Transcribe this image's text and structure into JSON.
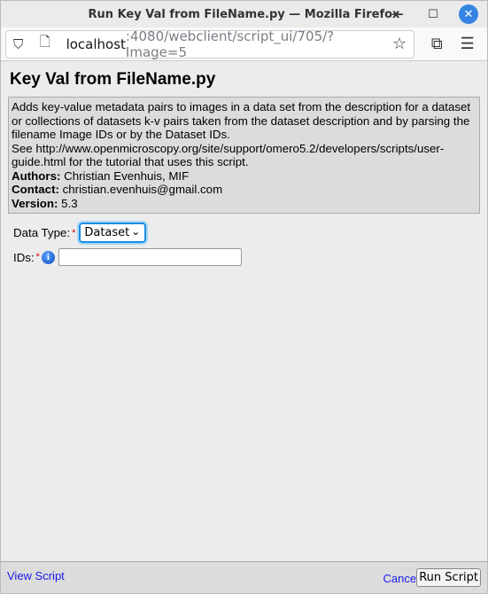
{
  "window": {
    "title": "Run Key Val from FileName.py — Mozilla Firefox"
  },
  "browser": {
    "url_host": "localhost",
    "url_rest": ":4080/webclient/script_ui/705/?Image=5"
  },
  "page": {
    "title": "Key Val from FileName.py",
    "description": "Adds key-value metadata pairs to images in a data set from the description for a dataset or collections of datasets k-v pairs taken from the dataset description and by parsing the filename Image IDs or by the Dataset IDs.",
    "tutorial": "See http://www.openmicroscopy.org/site/support/omero5.2/developers/scripts/user-guide.html for the tutorial that uses this script.",
    "authors_label": "Authors:",
    "authors": "Christian Evenhuis, MIF",
    "contact_label": "Contact:",
    "contact": "christian.evenhuis@gmail.com",
    "version_label": "Version:",
    "version": "5.3"
  },
  "form": {
    "data_type_label": "Data Type:",
    "data_type_value": "Dataset",
    "ids_label": "IDs:",
    "ids_value": "",
    "required_mark": "*"
  },
  "footer": {
    "view_script": "View Script",
    "cancel": "Cancel",
    "run_script": "Run Script"
  }
}
